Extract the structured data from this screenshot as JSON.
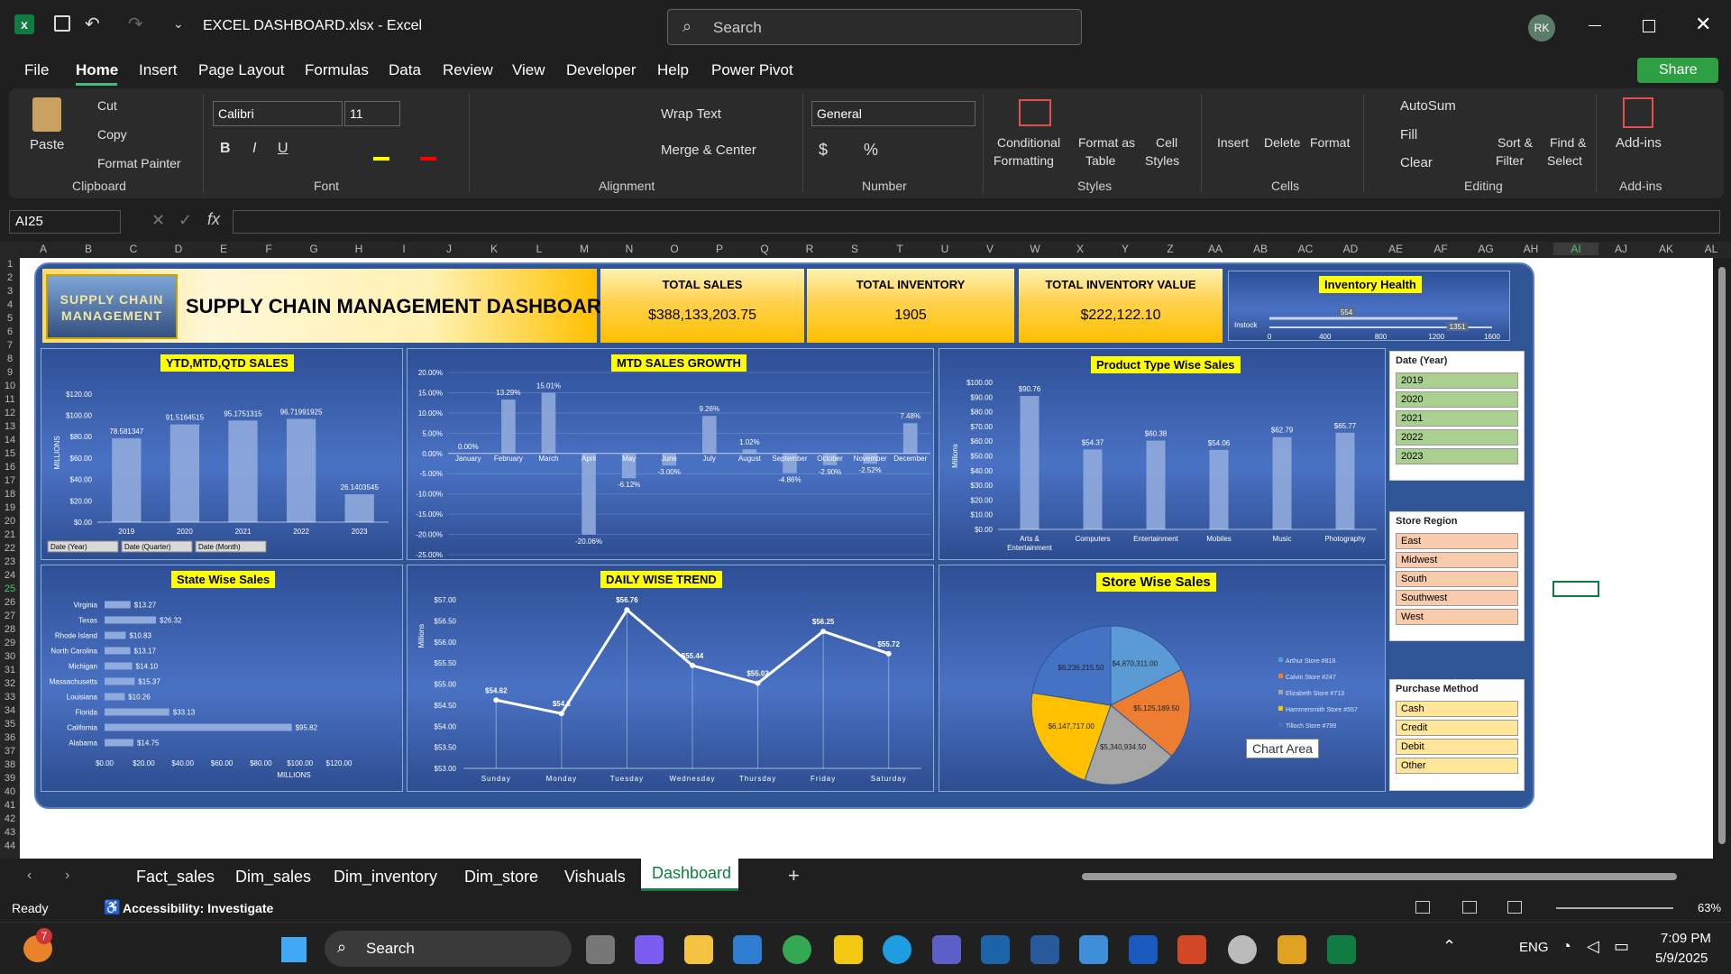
{
  "titlebar": {
    "file_title": "EXCEL DASHBOARD.xlsx  -  Excel",
    "search_placeholder": "Search",
    "user_initials": "RK"
  },
  "menu": [
    "File",
    "Home",
    "Insert",
    "Page Layout",
    "Formulas",
    "Data",
    "Review",
    "View",
    "Developer",
    "Help",
    "Power Pivot"
  ],
  "share_label": "Share",
  "ribbon": {
    "paste": "Paste",
    "cut": "Cut",
    "copy": "Copy",
    "format_painter": "Format Painter",
    "font_name": "Calibri",
    "font_size": "11",
    "wrap_text": "Wrap Text",
    "merge_center": "Merge & Center",
    "number_format": "General",
    "conditional": "Conditional",
    "formatting": "Formatting",
    "format_as": "Format as",
    "table": "Table",
    "cell": "Cell",
    "styles": "Styles",
    "insert": "Insert",
    "delete": "Delete",
    "format": "Format",
    "autosum": "AutoSum",
    "fill": "Fill",
    "clear": "Clear",
    "sort": "Sort &",
    "filter": "Filter",
    "find": "Find &",
    "select": "Select",
    "addins": "Add-ins",
    "groups": {
      "clipboard": "Clipboard",
      "font": "Font",
      "alignment": "Alignment",
      "number": "Number",
      "styles": "Styles",
      "cells": "Cells",
      "editing": "Editing",
      "addins": "Add-ins"
    }
  },
  "namebox": "AI25",
  "columns": [
    "A",
    "B",
    "C",
    "D",
    "E",
    "F",
    "G",
    "H",
    "I",
    "J",
    "K",
    "L",
    "M",
    "N",
    "O",
    "P",
    "Q",
    "R",
    "S",
    "T",
    "U",
    "V",
    "W",
    "X",
    "Y",
    "Z",
    "AA",
    "AB",
    "AC",
    "AD",
    "AE",
    "AF",
    "AG",
    "AH",
    "AI",
    "AJ",
    "AK",
    "AL"
  ],
  "dashboard": {
    "logo_text": "SUPPLY CHAIN MANAGEMENT",
    "title": "SUPPLY CHAIN MANAGEMENT DASHBOARD",
    "kpis": [
      {
        "label": "TOTAL SALES",
        "value": "$388,133,203.75"
      },
      {
        "label": "TOTAL INVENTORY",
        "value": "1905"
      },
      {
        "label": "TOTAL INVENTORY VALUE",
        "value": "$222,122.10"
      }
    ],
    "inventory_health": {
      "title": "Inventory Health",
      "row_label": "Instock",
      "marker1": "554",
      "marker2": "1351",
      "ticks": [
        "0",
        "400",
        "800",
        "1200",
        "1600"
      ],
      "value": 554,
      "target": 1351,
      "max": 1600
    }
  },
  "chart_data": [
    {
      "type": "bar",
      "title": "YTD,MTD,QTD SALES",
      "ylabel": "MILLIONS",
      "ylim": [
        0,
        130
      ],
      "yticks": [
        "$0.00",
        "$20.00",
        "$40.00",
        "$60.00",
        "$80.00",
        "$100.00",
        "$120.00"
      ],
      "categories": [
        "2019",
        "2020",
        "2021",
        "2022",
        "2023"
      ],
      "values": [
        78.581347,
        91.5164515,
        95.1751315,
        96.7199193,
        26.1403545
      ],
      "labels": [
        "78.581347",
        "91.5164515",
        "95.1751315",
        "96.71991925",
        "26.1403545"
      ],
      "field_buttons": [
        "Date (Year)",
        "Date (Quarter)",
        "Date (Month)"
      ]
    },
    {
      "type": "bar",
      "title": "MTD SALES GROWTH",
      "ylim": [
        -25,
        20
      ],
      "yticks": [
        "-25.00%",
        "-20.00%",
        "-15.00%",
        "-10.00%",
        "-5.00%",
        "0.00%",
        "5.00%",
        "10.00%",
        "15.00%",
        "20.00%"
      ],
      "categories": [
        "January",
        "February",
        "March",
        "April",
        "May",
        "June",
        "July",
        "August",
        "September",
        "October",
        "November",
        "December"
      ],
      "values": [
        0.0,
        13.29,
        15.01,
        -20.06,
        -6.12,
        -3.0,
        9.26,
        1.02,
        -4.86,
        -2.9,
        -2.52,
        7.48
      ],
      "labels": [
        "0.00%",
        "13.29%",
        "15.01%",
        "-20.06%",
        "-6.12%",
        "-3.00%",
        "9.26%",
        "1.02%",
        "-4.86%",
        "-2.90%",
        "-2.52%",
        "7.48%"
      ]
    },
    {
      "type": "bar",
      "title": "Product Type Wise Sales",
      "ylabel": "Millions",
      "ylim": [
        0,
        100
      ],
      "yticks": [
        "$0.00",
        "$10.00",
        "$20.00",
        "$30.00",
        "$40.00",
        "$50.00",
        "$60.00",
        "$70.00",
        "$80.00",
        "$90.00",
        "$100.00"
      ],
      "categories": [
        "Arts & Entertainment",
        "Computers",
        "Entertainment",
        "Mobiles",
        "Music",
        "Photography"
      ],
      "values": [
        90.76,
        54.37,
        60.38,
        54.06,
        62.79,
        65.77
      ],
      "labels": [
        "$90.76",
        "$54.37",
        "$60.38",
        "$54.06",
        "$62.79",
        "$65.77"
      ]
    },
    {
      "type": "bar",
      "title": "State Wise Sales",
      "xlabel": "MILLIONS",
      "xlim": [
        0,
        120
      ],
      "xticks": [
        "$0.00",
        "$20.00",
        "$40.00",
        "$60.00",
        "$80.00",
        "$100.00",
        "$120.00"
      ],
      "categories": [
        "Virginia",
        "Texas",
        "Rhode Island",
        "North Carolina",
        "Michigan",
        "Massachusetts",
        "Louisiana",
        "Florida",
        "California",
        "Alabama"
      ],
      "values": [
        13.27,
        26.32,
        10.83,
        13.17,
        14.1,
        15.37,
        10.26,
        33.13,
        95.82,
        14.75
      ],
      "labels": [
        "$13.27",
        "$26.32",
        "$10.83",
        "$13.17",
        "$14.10",
        "$15.37",
        "$10.26",
        "$33.13",
        "$95.82",
        "$14.75"
      ]
    },
    {
      "type": "line",
      "title": "DAILY  WISE TREND",
      "ylabel": "Millions",
      "ylim": [
        53,
        57
      ],
      "yticks": [
        "$53.00",
        "$53.50",
        "$54.00",
        "$54.50",
        "$55.00",
        "$55.50",
        "$56.00",
        "$56.50",
        "$57.00"
      ],
      "categories": [
        "Sunday",
        "Monday",
        "Tuesday",
        "Wednesday",
        "Thursday",
        "Friday",
        "Saturday"
      ],
      "values": [
        54.62,
        54.3,
        56.76,
        55.44,
        55.02,
        56.25,
        55.72
      ],
      "labels": [
        "$54.62",
        "$54.3",
        "$56.76",
        "$55.44",
        "$55.02",
        "$56.25",
        "$55.72"
      ]
    },
    {
      "type": "pie",
      "title": "Store Wise Sales",
      "series": [
        {
          "name": "Arthur Store #818",
          "value": 4870311.0,
          "label": "$4,870,311.00",
          "color": "#5b9bd5"
        },
        {
          "name": "Calvin Store #247",
          "value": 5125189.5,
          "label": "$5,125,189.50",
          "color": "#ed7d31"
        },
        {
          "name": "Elizabeth Store #713",
          "value": 5340934.5,
          "label": "$5,340,934.50",
          "color": "#a5a5a5"
        },
        {
          "name": "Hammersmith Store #557",
          "value": 6147717.0,
          "label": "$6,147,717.00",
          "color": "#ffc000"
        },
        {
          "name": "Tilloch Store #799",
          "value": 6236215.5,
          "label": "$6,236,215.50",
          "color": "#4472c4"
        }
      ],
      "tooltip": "Chart Area"
    }
  ],
  "slicers": {
    "date": {
      "title": "Date (Year)",
      "items": [
        "2019",
        "2020",
        "2021",
        "2022",
        "2023"
      ]
    },
    "region": {
      "title": "Store Region",
      "items": [
        "East",
        "Midwest",
        "South",
        "Southwest",
        "West"
      ]
    },
    "method": {
      "title": "Purchase Method",
      "items": [
        "Cash",
        "Credit",
        "Debit",
        "Other"
      ]
    }
  },
  "sheet_tabs": [
    "Fact_sales",
    "Dim_sales",
    "Dim_inventory",
    "Dim_store",
    "Vishuals",
    "Dashboard"
  ],
  "active_tab": "Dashboard",
  "status": {
    "ready": "Ready",
    "accessibility": "Accessibility: Investigate",
    "zoom": "63%"
  },
  "taskbar": {
    "search": "Search",
    "lang": "ENG",
    "time": "7:09 PM",
    "date": "5/9/2025",
    "badge": "7"
  },
  "colors": {
    "dash_bg": "#2f5597",
    "kpi": "#ffc000",
    "bar": "#8faadc",
    "title_yellow": "#ffff00",
    "excel_green": "#107c41"
  }
}
